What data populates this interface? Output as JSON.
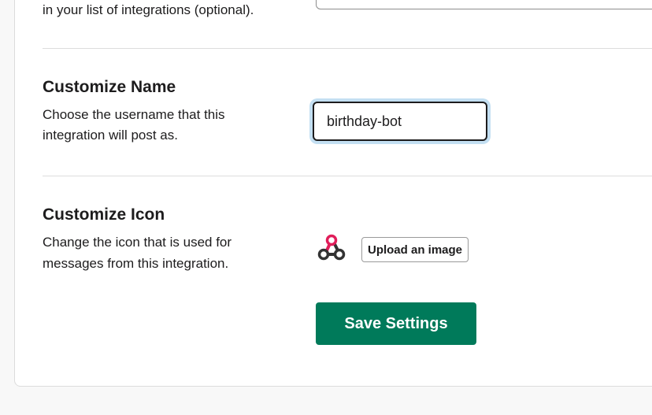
{
  "top_section": {
    "desc_tail": "in your list of integrations (optional)."
  },
  "customize_name": {
    "heading": "Customize Name",
    "desc_line1": "Choose the username that this",
    "desc_line2": "integration will post as.",
    "username_value": "birthday-bot"
  },
  "customize_icon": {
    "heading": "Customize Icon",
    "desc_line1": "Change the icon that is used for",
    "desc_line2": "messages from this integration.",
    "icon": "webhook-icon",
    "upload_label": "Upload an image"
  },
  "save_label": "Save Settings",
  "colors": {
    "primary_button": "#007a5a",
    "focus_ring": "#c3dff2",
    "icon_accent": "#e01e5a",
    "icon_dark": "#333333"
  }
}
